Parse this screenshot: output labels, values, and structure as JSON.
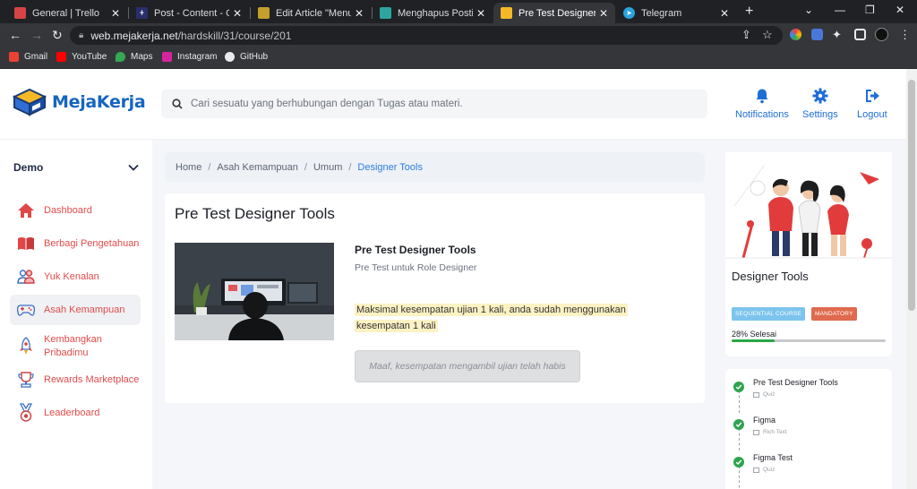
{
  "browser": {
    "tabs": [
      {
        "label": "General | Trello",
        "favicon": "trello-icon",
        "color": "#d64545"
      },
      {
        "label": "Post - Content - Graph",
        "favicon": "hashnode-icon",
        "color": "#2a2f6b"
      },
      {
        "label": "Edit Article \"Menu da",
        "favicon": "edit-article-icon",
        "color": "#c4a02b"
      },
      {
        "label": "Menghapus Postingan",
        "favicon": "blog-icon",
        "color": "#2ea4a0"
      },
      {
        "label": "Pre Test Designer Tools",
        "favicon": "mejakerja-icon",
        "color": "#f5b928"
      },
      {
        "label": "Telegram",
        "favicon": "telegram-icon",
        "color": "#2aa3e0"
      }
    ],
    "active_tab": 4,
    "url_host": "web.mejakerja.net",
    "url_path": "/hardskill/31/course/201",
    "bookmarks": [
      {
        "label": "Gmail",
        "icon": "gmail-icon",
        "color": "#ea4335"
      },
      {
        "label": "YouTube",
        "icon": "youtube-icon",
        "color": "#ff0000"
      },
      {
        "label": "Maps",
        "icon": "maps-icon",
        "color": "#34a853"
      },
      {
        "label": "Instagram",
        "icon": "instagram-icon",
        "color": "#d6249f"
      },
      {
        "label": "GitHub",
        "icon": "github-icon",
        "color": "#e8eaed"
      }
    ]
  },
  "header": {
    "logo_text": "MejaKerja",
    "search_placeholder": "Cari sesuatu yang berhubungan dengan Tugas atau materi.",
    "actions": [
      {
        "label": "Notifications",
        "icon": "bell-icon"
      },
      {
        "label": "Settings",
        "icon": "gear-icon"
      },
      {
        "label": "Logout",
        "icon": "logout-icon"
      }
    ],
    "accent": "#1e6ed6"
  },
  "sidebar": {
    "workspace": "Demo",
    "items": [
      {
        "label": "Dashboard",
        "icon": "home-icon"
      },
      {
        "label": "Berbagi Pengetahuan",
        "icon": "book-icon"
      },
      {
        "label": "Yuk Kenalan",
        "icon": "people-icon"
      },
      {
        "label": "Asah Kemampuan",
        "icon": "gamepad-icon",
        "active": true
      },
      {
        "label": "Kembangkan Pribadimu",
        "icon": "rocket-icon"
      },
      {
        "label": "Rewards Marketplace",
        "icon": "trophy-icon"
      },
      {
        "label": "Leaderboard",
        "icon": "medal-icon"
      }
    ],
    "label_color": "#e24b4b"
  },
  "breadcrumb": {
    "items": [
      "Home",
      "Asah Kemampuan",
      "Umum"
    ],
    "current": "Designer Tools"
  },
  "main": {
    "title": "Pre Test Designer Tools",
    "test_name": "Pre Test Designer Tools",
    "test_subtitle": "Pre Test untuk Role Designer",
    "warning": "Maksimal kesempatan ujian 1 kali, anda sudah menggunakan kesempatan 1 kali",
    "button_label": "Maaf, kesempatan mengambil ujian telah habis",
    "thumbnail": "designer-workspace-photo"
  },
  "course": {
    "title": "Designer Tools",
    "badges": [
      {
        "label": "SEQUENTIAL COURSE",
        "color": "#7cc4ee"
      },
      {
        "label": "MANDATORY",
        "color": "#e06a4e"
      }
    ],
    "progress_label": "28% Selesai",
    "progress": 0.28,
    "lessons": [
      {
        "name": "Pre Test Designer Tools",
        "type": "Quiz",
        "done": true
      },
      {
        "name": "Figma",
        "type": "Rich Text",
        "done": true
      },
      {
        "name": "Figma Test",
        "type": "Quiz",
        "done": true
      }
    ]
  }
}
